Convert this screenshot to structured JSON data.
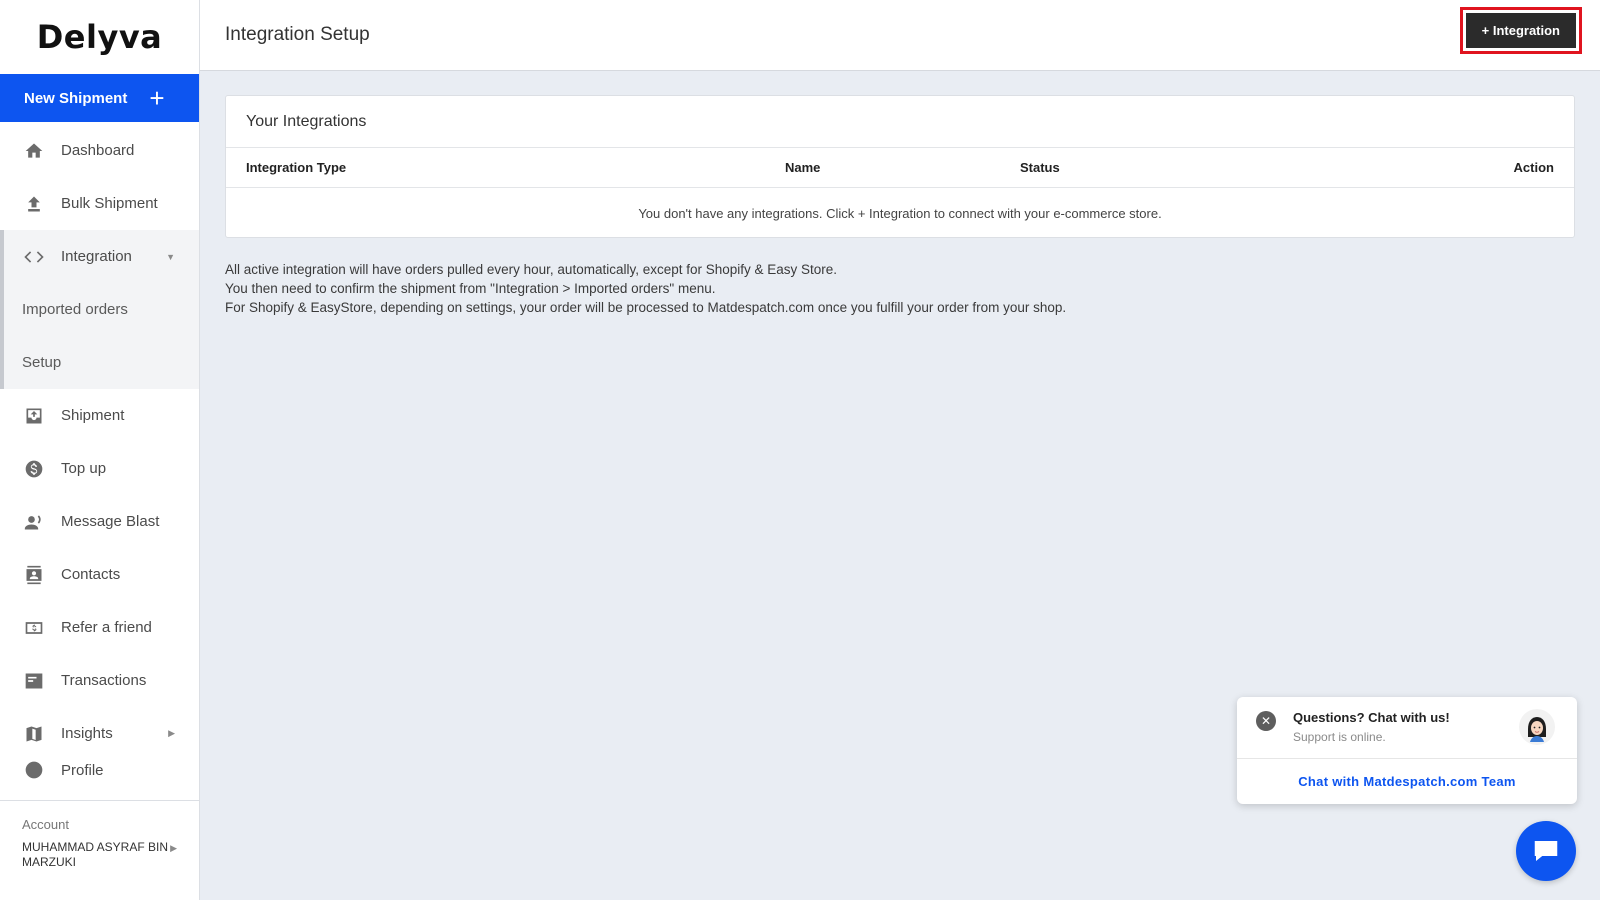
{
  "brand": {
    "logo_text": "Delyva"
  },
  "sidebar": {
    "new_shipment_label": "New Shipment",
    "items": [
      {
        "label": "Dashboard",
        "icon": "home-icon"
      },
      {
        "label": "Bulk Shipment",
        "icon": "upload-icon"
      },
      {
        "label": "Integration",
        "icon": "code-icon"
      },
      {
        "label": "Shipment",
        "icon": "inbox-icon"
      },
      {
        "label": "Top up",
        "icon": "dollar-icon"
      },
      {
        "label": "Message Blast",
        "icon": "broadcast-user-icon"
      },
      {
        "label": "Contacts",
        "icon": "contacts-icon"
      },
      {
        "label": "Refer a friend",
        "icon": "refer-icon"
      },
      {
        "label": "Transactions",
        "icon": "card-icon"
      },
      {
        "label": "Insights",
        "icon": "map-icon"
      },
      {
        "label": "Profile",
        "icon": "user-icon"
      }
    ],
    "integration_sub": [
      "Imported orders",
      "Setup"
    ]
  },
  "account": {
    "label": "Account",
    "name": "MUHAMMAD ASYRAF BIN MARZUKI"
  },
  "header": {
    "title": "Integration Setup",
    "add_button": "+ Integration"
  },
  "integrations": {
    "title": "Your Integrations",
    "columns": [
      "Integration Type",
      "Name",
      "Status",
      "Action"
    ],
    "empty_message": "You don't have any integrations. Click + Integration to connect with your e-commerce store."
  },
  "notes": [
    "All active integration will have orders pulled every hour, automatically, except for Shopify & Easy Store.",
    "You then need to confirm the shipment from \"Integration > Imported orders\" menu.",
    "For Shopify & EasyStore, depending on settings, your order will be processed to Matdespatch.com once you fulfill your order from your shop."
  ],
  "chat": {
    "question": "Questions? Chat with us!",
    "status": "Support is online.",
    "link": "Chat with Matdespatch.com Team"
  },
  "colors": {
    "primary": "#0d55f0",
    "dark_button": "#2b2b2b",
    "highlight_border": "#e0141f",
    "background": "#e9edf3"
  }
}
